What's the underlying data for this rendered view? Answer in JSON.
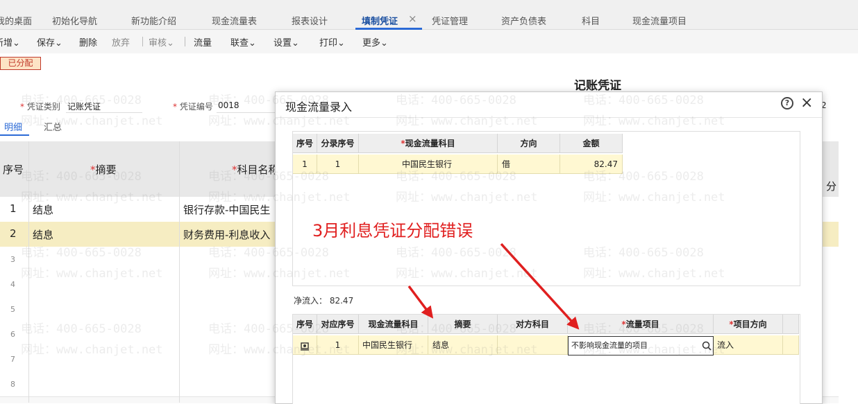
{
  "tabs": [
    {
      "label": "我的桌面"
    },
    {
      "label": "初始化导航"
    },
    {
      "label": "新功能介绍"
    },
    {
      "label": "现金流量表"
    },
    {
      "label": "报表设计"
    },
    {
      "label": "填制凭证"
    },
    {
      "label": "凭证管理"
    },
    {
      "label": "资产负债表"
    },
    {
      "label": "科目"
    },
    {
      "label": "现金流量项目"
    }
  ],
  "tab_close": "×",
  "toolbar": {
    "new": "新增",
    "save": "保存",
    "delete": "删除",
    "abandon": "放弃",
    "audit": "审核",
    "flow": "流量",
    "link": "联查",
    "settings": "设置",
    "print": "打印",
    "more": "更多"
  },
  "status_badge": "已分配",
  "voucher": {
    "title": "记账凭证",
    "type_label": "凭证类别",
    "type_value": "记账凭证",
    "number_label": "凭证编号",
    "number_value": "0018",
    "right_fragment": "2"
  },
  "subtabs": {
    "detail": "明细",
    "summary": "汇总"
  },
  "bg_table": {
    "headers": {
      "seq": "序号",
      "summary": "摘要",
      "account": "科目名称",
      "right_fragment": "分"
    },
    "rows": [
      {
        "seq": "1",
        "summary": "结息",
        "account": "银行存款-中国民生"
      },
      {
        "seq": "2",
        "summary": "结息",
        "account": "财务费用-利息收入"
      }
    ],
    "empty_rows": [
      "3",
      "4",
      "5",
      "6",
      "7",
      "8"
    ]
  },
  "modal": {
    "title": "现金流量录入",
    "help": "?",
    "close": "×",
    "top_table": {
      "headers": [
        "序号",
        "分录序号",
        "现金流量科目",
        "方向",
        "金额"
      ],
      "row": {
        "seq": "1",
        "entry": "1",
        "account": "中国民生银行",
        "direction": "借",
        "amount": "82.47"
      }
    },
    "net_inflow_label": "净流入：",
    "net_inflow_value": "82.47",
    "bottom_table": {
      "headers": [
        "序号",
        "对应序号",
        "现金流量科目",
        "摘要",
        "对方科目",
        "流量项目",
        "项目方向"
      ],
      "row": {
        "entry": "1",
        "account": "中国民生银行",
        "summary": "结息",
        "counter_account": "",
        "flow_item": "不影响现金流量的项目",
        "direction": "流入"
      }
    }
  },
  "annotation": "3月利息凭证分配错误",
  "watermark": {
    "phone": "电话：400-665-0028",
    "site": "网址：www.chanjet.net"
  },
  "colors": {
    "accent": "#2b6ad6",
    "annotation": "#e01f1f",
    "highlight_row": "#fff8d2",
    "badge": "#c0392b"
  },
  "icons": [
    "chevron-down-icon",
    "help-icon",
    "close-icon",
    "gear-icon",
    "search-icon",
    "arrow-icon"
  ]
}
